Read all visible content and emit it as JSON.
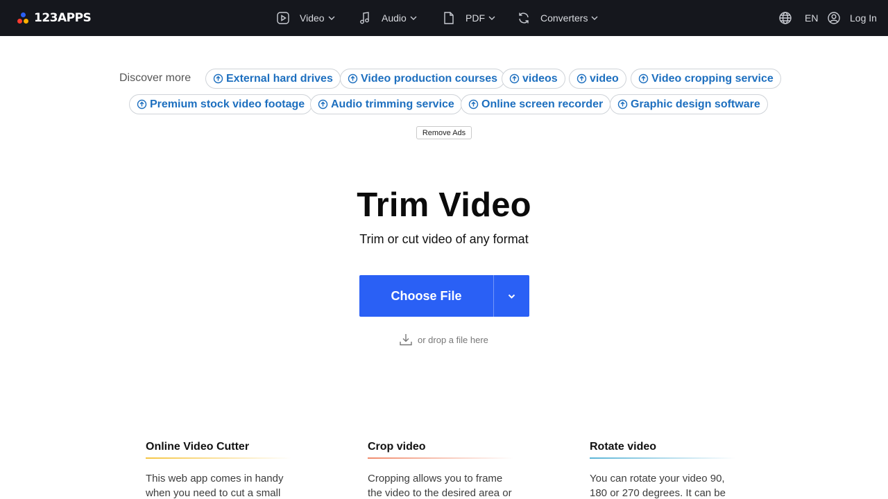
{
  "header": {
    "logo_text": "123APPS",
    "logo_colors": [
      "#2a60f5",
      "#ff3b30",
      "#ffb000"
    ],
    "nav": [
      {
        "label": "Video",
        "icon": "play-file-icon"
      },
      {
        "label": "Audio",
        "icon": "music-note-icon"
      },
      {
        "label": "PDF",
        "icon": "document-icon"
      },
      {
        "label": "Converters",
        "icon": "refresh-icon"
      }
    ],
    "language": "EN",
    "login": "Log In"
  },
  "discover": {
    "label": "Discover more",
    "chips": [
      "External hard drives",
      "Video production courses",
      "videos",
      "video",
      "Video cropping service",
      "Premium stock video footage",
      "Audio trimming service",
      "Online screen recorder",
      "Graphic design software"
    ],
    "remove_ads": "Remove Ads"
  },
  "hero": {
    "title": "Trim Video",
    "subtitle": "Trim or cut video of any format",
    "choose_file": "Choose File",
    "drop_hint": "or drop a file here",
    "accent": "#2a60f5"
  },
  "features": [
    {
      "title": "Online Video Cutter",
      "text": "This web app comes in handy when you need to cut a small",
      "colors": [
        "#f5c542",
        "#ffffff"
      ]
    },
    {
      "title": "Crop video",
      "text": "Cropping allows you to frame the video to the desired area or",
      "colors": [
        "#f08a6b",
        "#ffffff"
      ]
    },
    {
      "title": "Rotate video",
      "text": "You can rotate your video 90, 180 or 270 degrees. It can be",
      "colors": [
        "#5ab4d6",
        "#ffffff"
      ]
    }
  ]
}
